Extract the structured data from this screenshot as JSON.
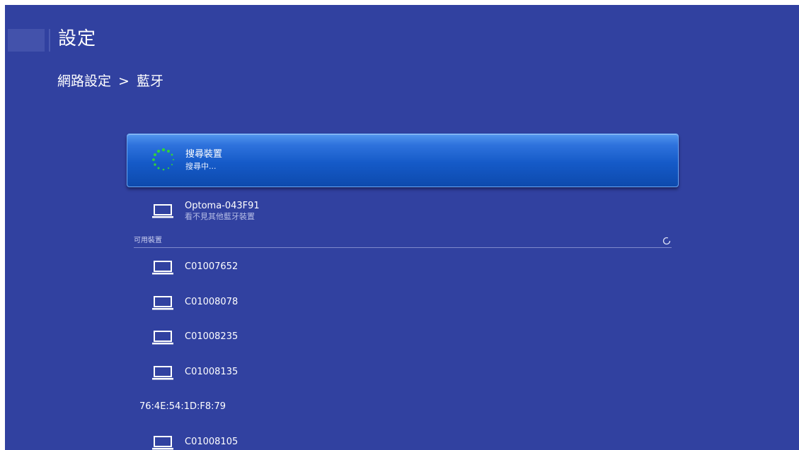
{
  "header": {
    "title": "設定"
  },
  "breadcrumb": {
    "parent": "網路設定",
    "separator": ">",
    "current": "藍牙"
  },
  "search_card": {
    "title": "搜尋裝置",
    "status": "搜尋中..."
  },
  "paired_device": {
    "name": "Optoma-043F91",
    "subtitle": "看不見其他藍牙裝置",
    "icon": "laptop-icon"
  },
  "available_section": {
    "label": "可用裝置",
    "icon": "refresh-icon"
  },
  "devices": [
    {
      "name": "C01007652",
      "icon": "laptop-icon"
    },
    {
      "name": "C01008078",
      "icon": "laptop-icon"
    },
    {
      "name": "C01008235",
      "icon": "laptop-icon"
    },
    {
      "name": "C01008135",
      "icon": "laptop-icon"
    },
    {
      "name": "76:4E:54:1D:F8:79",
      "icon": ""
    },
    {
      "name": "C01008105",
      "icon": "laptop-icon"
    }
  ],
  "colors": {
    "background": "#3141a0",
    "highlight": "#155ac8",
    "spinner": "#31d23c"
  }
}
